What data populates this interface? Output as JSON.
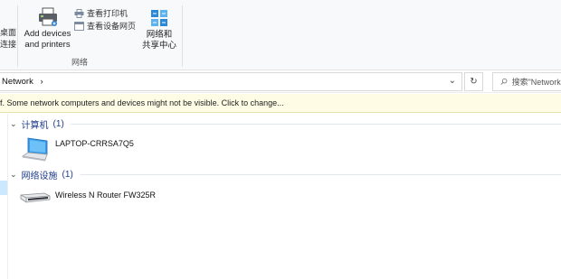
{
  "ribbon": {
    "cut_label_line1": "桌面",
    "cut_label_line2": "连接",
    "add_devices_line1": "Add devices",
    "add_devices_line2": "and printers",
    "view_printers": "查看打印机",
    "view_device_webpage": "查看设备网页",
    "network_center_line1": "网络和",
    "network_center_line2": "共享中心",
    "group_label": "网络"
  },
  "address": {
    "path": "Network",
    "separator": "›",
    "dropdown_glyph": "⌄",
    "refresh_glyph": "↻",
    "search_placeholder": "搜索\"Network\""
  },
  "infobar": {
    "text": "f. Some network computers and devices might not be visible. Click to change..."
  },
  "groups": [
    {
      "title": "计算机",
      "count": "(1)",
      "items": [
        {
          "name": "LAPTOP-CRRSA7Q5",
          "icon": "laptop-icon"
        }
      ]
    },
    {
      "title": "网络设施",
      "count": "(1)",
      "items": [
        {
          "name": "Wireless N Router FW325R",
          "icon": "router-icon"
        }
      ]
    }
  ],
  "colors": {
    "group_header": "#1e3c8c",
    "infobar_bg": "#fffce6",
    "nav_selected": "#cce8ff"
  }
}
